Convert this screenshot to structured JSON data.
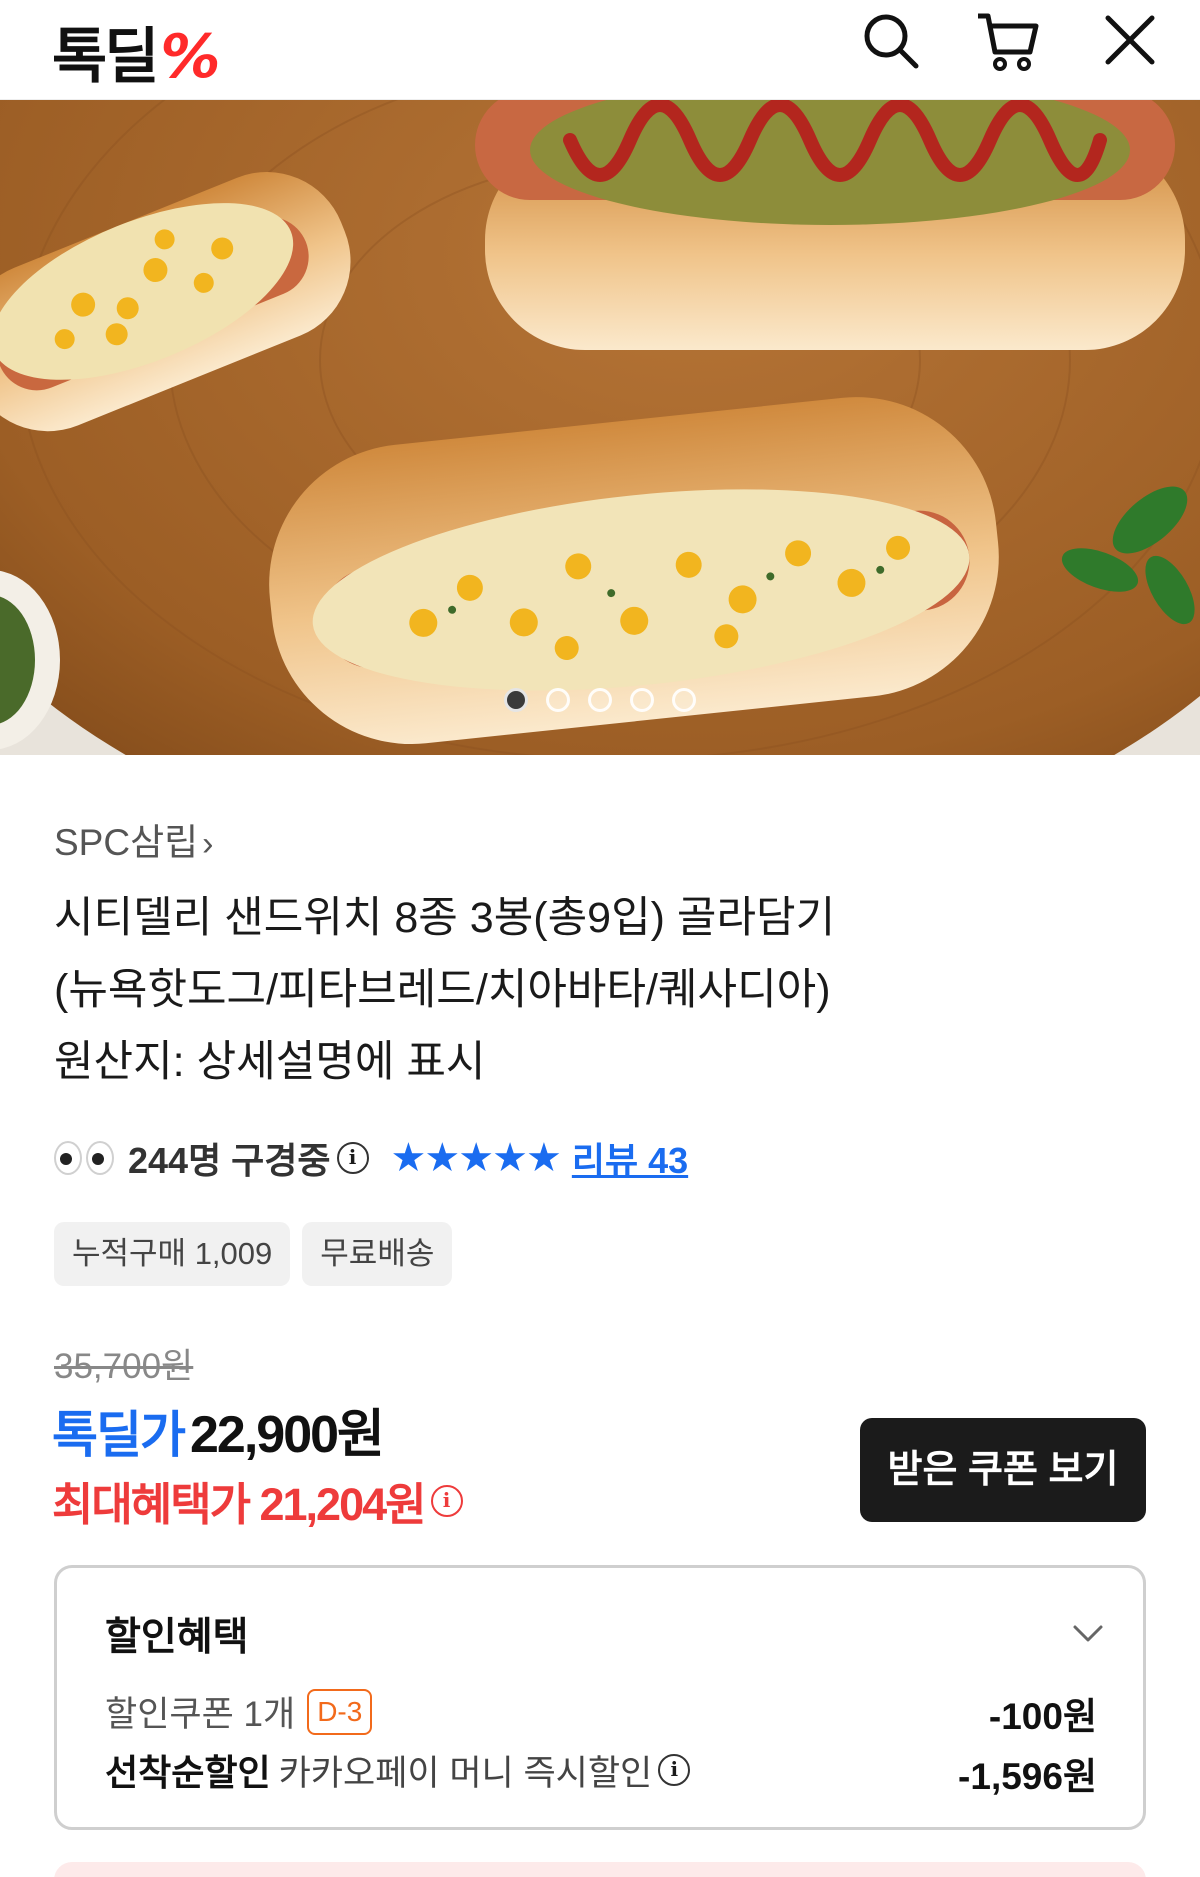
{
  "header": {
    "logo_text": "톡딜",
    "logo_mark": "%",
    "icons": [
      "search-icon",
      "cart-icon",
      "close-icon"
    ]
  },
  "gallery": {
    "total_images": 5,
    "active_index": 0
  },
  "product": {
    "brand": "SPC삼립",
    "brand_chevron": "›",
    "title_line1": "시티델리 샌드위치 8종 3봉(총9입) 골라담기",
    "title_line2": "(뉴욕핫도그/피타브레드/치아바타/퀘사디아)",
    "title_line3": "원산지: 상세설명에 표시",
    "viewers": "244명 구경중",
    "info_glyph": "i",
    "rating_stars": 5,
    "stars": "★★★★★",
    "review_link": "리뷰 43",
    "tags": [
      "누적구매 1,009",
      "무료배송"
    ]
  },
  "price": {
    "original": "35,700원",
    "deal_label": "톡딜가",
    "deal_price": "22,900원",
    "max_benefit": "최대혜택가 21,204원",
    "coupon_button": "받은 쿠폰 보기"
  },
  "discount": {
    "title": "할인혜택",
    "coupon_label": "할인쿠폰 1개",
    "coupon_dday": "D-3",
    "coupon_value": "-100원",
    "firstcome_label": "선착순할인",
    "firstcome_sub": "카카오페이 머니 즉시할인",
    "firstcome_value": "-1,596원"
  },
  "colors": {
    "accent_blue": "#1a6cf0",
    "accent_red": "#ee3b3b",
    "logo_red": "#ff2a2a",
    "dday_orange": "#f26a1b"
  }
}
